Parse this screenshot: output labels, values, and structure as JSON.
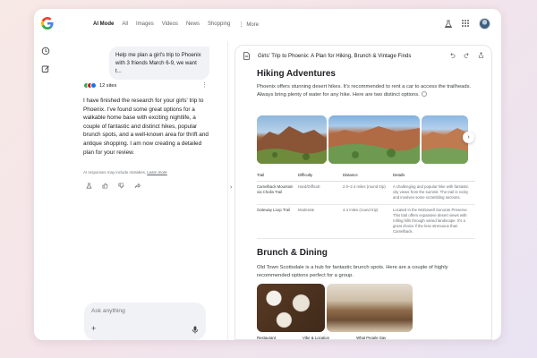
{
  "topbar": {
    "tabs": [
      "AI Mode",
      "All",
      "Images",
      "Videos",
      "News",
      "Shopping"
    ],
    "more_label": "More"
  },
  "chat": {
    "user_message": "Help me plan a girl's trip to Phoenix with 3 friends March 6-9, we want t...",
    "sites_label": "12 sites",
    "answer": "I have finished the research for your girls' trip to Phoenix. I've found some great options for a walkable home base with exciting nightlife, a couple of fantastic and distinct hikes, popular brunch spots, and a well-known area for thrift and antique shopping. I am now creating a detailed plan for your review.",
    "disclaimer": "AI responses may include mistakes.",
    "learn_more": "Learn more",
    "ask_placeholder": "Ask anything"
  },
  "panel": {
    "title": "Girls' Trip to Phoenix: A Plan for Hiking, Brunch & Vintage Finds",
    "hiking": {
      "heading": "Hiking Adventures",
      "intro": "Phoenix offers stunning desert hikes. It's recommended to rent a car to access the trailheads. Always bring plenty of water for any hike. Here are two distinct options."
    },
    "table": {
      "headers": [
        "Trail",
        "Difficulty",
        "Distance",
        "Details"
      ],
      "rows": [
        [
          "Camelback Mountain via Cholla Trail",
          "Hard/Difficult",
          "2.0–2.4 miles (round trip)",
          "A challenging and popular hike with fantastic city views from the summit. The trail is rocky and involves some scrambling sections."
        ],
        [
          "Gateway Loop Trail",
          "Moderate",
          "4.4 miles (round trip)",
          "Located in the McDowell Sonoran Preserve. This trail offers expansive desert views with rolling hills through varied landscape. It's a great choice if the less strenuous than Camelback."
        ]
      ]
    },
    "brunch": {
      "heading": "Brunch & Dining",
      "intro": "Old Town Scottsdale is a hub for fantastic brunch spots. Here are a couple of highly recommended options perfect for a group."
    },
    "brunch_headers": [
      "Restaurant",
      "Vibe & Location",
      "What People Say"
    ]
  },
  "colors": {
    "accent_blue": "#1a73e8",
    "panel_border": "#e4e6ea",
    "chat_bubble": "#f0f2f5"
  }
}
